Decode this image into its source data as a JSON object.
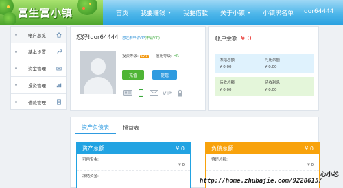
{
  "header": {
    "logo": "富生富小镇",
    "nav": [
      {
        "label": "首页",
        "dropdown": false
      },
      {
        "label": "我要赚钱",
        "dropdown": true
      },
      {
        "label": "我要借款",
        "dropdown": false
      },
      {
        "label": "关于小镇",
        "dropdown": true
      },
      {
        "label": "小镇黑名单",
        "dropdown": false
      }
    ],
    "user": "dor64444"
  },
  "sidebar": {
    "items": [
      {
        "label": "帐户总览",
        "icon": "home-icon"
      },
      {
        "label": "基本设置",
        "icon": "wrench-icon"
      },
      {
        "label": "资金管理",
        "icon": "money-icon"
      },
      {
        "label": "投资管理",
        "icon": "chart-icon"
      },
      {
        "label": "借款管理",
        "icon": "document-icon"
      }
    ]
  },
  "profile": {
    "greeting": "您好!dor64444",
    "vip_link_prefix": "您还未申请VIP",
    "vip_link_action": "(申请VIP)",
    "invest_level_label": "投资等级:",
    "invest_level_value": "LV 1",
    "credit_level_label": "信用等级:",
    "credit_level_value": "HR",
    "recharge_button": "充值",
    "withdraw_button": "提现",
    "verify_icons": [
      "id-card-icon",
      "mobile-icon",
      "email-icon",
      "vip-icon",
      "lock-icon"
    ]
  },
  "balance": {
    "title": "帐户余额:",
    "amount": "¥ 0",
    "row1": [
      {
        "label": "冻结总额",
        "value": "¥ 0.00"
      },
      {
        "label": "可用余额",
        "value": "¥ 0.00"
      }
    ],
    "row2": [
      {
        "label": "待收总额",
        "value": "¥ 0.00"
      },
      {
        "label": "待收利息",
        "value": "¥ 0.00"
      }
    ]
  },
  "tabs": [
    {
      "label": "资产负债表",
      "active": true
    },
    {
      "label": "损益表",
      "active": false
    }
  ],
  "assets_card": {
    "title": "资产总额",
    "total": "¥ 0",
    "rows": [
      {
        "label": "可用资金:",
        "value": "¥ 0"
      },
      {
        "label": "冻结资金:",
        "value": ""
      }
    ]
  },
  "liabilities_card": {
    "title": "负债总额",
    "total": "¥ 0",
    "rows": [
      {
        "label": "待还总额:",
        "value": "¥ 0"
      }
    ]
  },
  "watermark": {
    "line1": "心小芯",
    "line2": "http://home.zhubajie.com/9228615/"
  },
  "colors": {
    "primary_blue": "#22a3e2",
    "orange": "#f8a20c",
    "green_button": "#4fb535",
    "balance_red": "#e8322d"
  }
}
